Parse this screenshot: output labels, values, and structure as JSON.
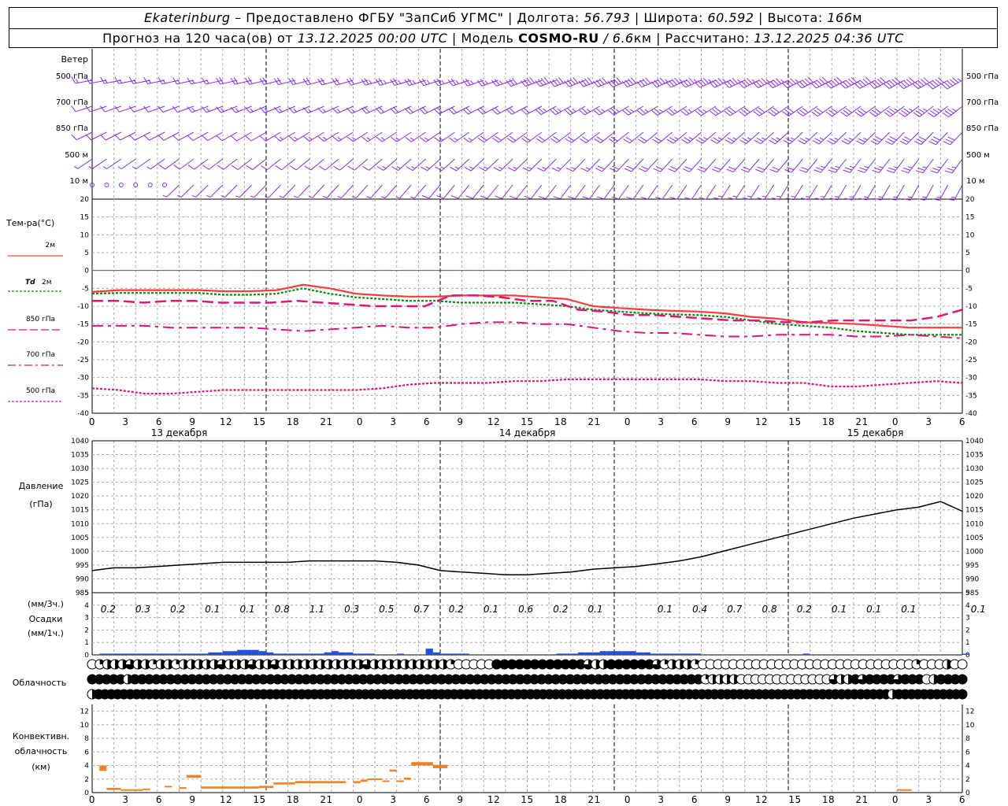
{
  "header": {
    "city": "Ekaterinburg",
    "provider": "– Предоставлено ФГБУ \"ЗапСиб УГМС\"",
    "lon_label": "| Долгота:",
    "lon": "56.793",
    "lat_label": "| Широта:",
    "lat": "60.592",
    "alt_label": "| Высота:",
    "alt": "166",
    "alt_unit": "м",
    "forecast_label": "Прогноз на 120 часа(ов) от",
    "forecast_time": "13.12.2025 00:00 UTC",
    "model_label": "| Модель",
    "model": "COSMO-RU",
    "resolution": "/ 6.6",
    "res_unit": "км",
    "computed_label": "| Рассчитано:",
    "computed_time": "13.12.2025 04:36 UTC"
  },
  "labels": {
    "wind_title": "Ветер",
    "wind_levels": [
      "500 гПа",
      "700 гПа",
      "850 гПа",
      "500 м",
      "10 м"
    ],
    "temp_title": "Тем-ра(°C)",
    "t2m": "2м",
    "td": "Td",
    "td_suffix": "2м",
    "l850": "850 гПа",
    "l700": "700 гПа",
    "l500": "500 гПа",
    "pressure_title": "Давление",
    "pressure_unit": "(гПа)",
    "precip_unit3": "(мм/3ч.)",
    "precip_title": "Осадки",
    "precip_unit1": "(мм/1ч.)",
    "cloud_title": "Облачность",
    "conv_title1": "Конвективн.",
    "conv_title2": "облачность",
    "conv_unit": "(км)"
  },
  "colors": {
    "wind": "#8a2be2",
    "t2m": "#ff3b3b",
    "td": "#0a8a0a",
    "t850": "#e0157a",
    "t700": "#e0157a",
    "t500": "#e0157a",
    "zero_line": "#3a5fd0",
    "pressure": "#000000",
    "precip": "#1f4fe0",
    "conv": "#f08020",
    "grid": "#aaaaaa"
  },
  "chart_data": [
    {
      "type": "line",
      "name": "temperature",
      "x_hours": [
        0,
        3,
        6,
        9,
        12,
        15,
        18,
        21,
        24,
        27,
        30,
        33,
        36,
        39,
        42,
        45,
        48,
        51,
        54,
        57,
        60,
        63,
        66,
        69,
        72,
        75,
        78,
        81,
        84,
        87,
        90,
        93,
        96,
        99,
        102,
        105,
        108,
        111,
        114,
        117,
        120
      ],
      "x_tick_labels": [
        "0",
        "3",
        "6",
        "9",
        "12",
        "15",
        "18",
        "21",
        "0",
        "3",
        "6",
        "9",
        "12",
        "15",
        "18",
        "21",
        "0",
        "3",
        "6",
        "9",
        "12",
        "15",
        "18",
        "21",
        "0",
        "3",
        "6"
      ],
      "date_labels": [
        "13 декабря",
        "14 декабря",
        "15 декабря"
      ],
      "ylim": [
        -40,
        20
      ],
      "y_ticks": [
        20,
        15,
        10,
        5,
        0,
        -5,
        -10,
        -15,
        -20,
        -25,
        -30,
        -35,
        -40
      ],
      "series": [
        {
          "name": "2м",
          "values": [
            -6,
            -5.5,
            -5.5,
            -5.5,
            -5.5,
            -5.8,
            -5.8,
            -5.5,
            -4,
            -5,
            -6.5,
            -7,
            -7.3,
            -7.3,
            -7,
            -7,
            -7,
            -7.5,
            -8,
            -10,
            -10.5,
            -11,
            -11.3,
            -11.5,
            -12,
            -13,
            -13.5,
            -14.5,
            -14.7,
            -15,
            -15.5,
            -16,
            -16,
            -16
          ]
        },
        {
          "name": "Td 2м",
          "values": [
            -6.5,
            -6.3,
            -6.3,
            -6.3,
            -6.3,
            -6.8,
            -6.8,
            -6.5,
            -5,
            -6.5,
            -7.5,
            -8,
            -8.5,
            -8.5,
            -9,
            -9,
            -9,
            -9.5,
            -10,
            -11,
            -11.5,
            -12,
            -12.3,
            -12.5,
            -13,
            -14,
            -15,
            -15.5,
            -16,
            -17,
            -17.5,
            -18,
            -18,
            -18
          ]
        },
        {
          "name": "850 гПа",
          "values": [
            -8.5,
            -8.5,
            -9,
            -8.5,
            -8.5,
            -9,
            -9,
            -9,
            -8.5,
            -9,
            -9.5,
            -10,
            -10,
            -10,
            -7,
            -7,
            -7.5,
            -8.5,
            -8.5,
            -11,
            -11.5,
            -12.5,
            -12.5,
            -13,
            -13.5,
            -14,
            -14,
            -14.5,
            -14.5,
            -14,
            -14,
            -14,
            -14,
            -13,
            -11
          ]
        },
        {
          "name": "700 гПа",
          "values": [
            -15.5,
            -15.5,
            -15.5,
            -16,
            -16,
            -16,
            -16,
            -16.5,
            -17,
            -16.5,
            -16,
            -15.5,
            -16,
            -16,
            -15,
            -14.5,
            -14.5,
            -15,
            -15,
            -16,
            -17,
            -17.5,
            -17.5,
            -18,
            -18.5,
            -18.5,
            -18,
            -18,
            -18,
            -18.5,
            -18.5,
            -18,
            -18.5,
            -19
          ]
        },
        {
          "name": "500 гПа",
          "values": [
            -33,
            -33.5,
            -34.5,
            -34.5,
            -34,
            -33.5,
            -33.5,
            -33.5,
            -33.5,
            -33.5,
            -33.5,
            -33,
            -32,
            -31.5,
            -31.5,
            -31.5,
            -31,
            -31,
            -30.5,
            -30.5,
            -30.5,
            -30.5,
            -30.5,
            -30.5,
            -31,
            -31,
            -31.5,
            -31.5,
            -32.5,
            -32.5,
            -32,
            -31.5,
            -31,
            -31.5
          ]
        }
      ]
    },
    {
      "type": "line",
      "name": "pressure",
      "ylim": [
        985,
        1040
      ],
      "y_ticks": [
        1040,
        1035,
        1030,
        1025,
        1020,
        1015,
        1010,
        1005,
        1000,
        995,
        990,
        985
      ],
      "x_hours": [
        0,
        3,
        6,
        9,
        12,
        15,
        18,
        21,
        24,
        27,
        30,
        33,
        36,
        39,
        42,
        45,
        48,
        51,
        54,
        57,
        60,
        63,
        66,
        69,
        72,
        75,
        78,
        81,
        84,
        87,
        90,
        93,
        96,
        99,
        102,
        105,
        108,
        111,
        114,
        117,
        120
      ],
      "values": [
        993,
        994,
        994,
        994.5,
        995,
        995.5,
        996,
        996,
        996,
        996,
        996.5,
        996.5,
        996.5,
        996.5,
        996,
        995,
        993,
        992.5,
        992,
        991.5,
        991.5,
        992,
        992.5,
        993.5,
        994,
        994.5,
        995.5,
        996.5,
        998,
        1000,
        1002,
        1004,
        1006,
        1008,
        1010,
        1012,
        1013.5,
        1015,
        1016,
        1018,
        1014.5
      ]
    },
    {
      "type": "bar",
      "name": "precipitation",
      "ylim": [
        0,
        5
      ],
      "y_ticks": [
        5,
        4,
        3,
        2,
        1,
        0
      ],
      "sums_3h": [
        "0.2",
        "0.3",
        "0.2",
        "0.1",
        "0.1",
        "0.8",
        "1.1",
        "0.3",
        "0.5",
        "0.7",
        "0.2",
        "0.1",
        "0.6",
        "0.2",
        "0.1",
        "",
        "0.1",
        "0.4",
        "0.7",
        "0.8",
        "0.2",
        "0.1",
        "0.1",
        "0.1",
        "",
        "0.1"
      ],
      "hourly_values": [
        0,
        0.1,
        0.1,
        0.1,
        0.1,
        0.1,
        0.1,
        0.1,
        0.1,
        0.1,
        0.1,
        0.1,
        0.1,
        0.1,
        0.1,
        0.1,
        0.2,
        0.2,
        0.3,
        0.3,
        0.4,
        0.4,
        0.4,
        0.3,
        0.2,
        0.1,
        0.1,
        0.1,
        0.1,
        0.1,
        0.1,
        0.1,
        0.2,
        0.3,
        0.2,
        0.2,
        0.1,
        0.1,
        0.1,
        0,
        0,
        0,
        0.1,
        0,
        0,
        0,
        0.5,
        0.2,
        0.1,
        0.1,
        0.1,
        0.1,
        0,
        0,
        0,
        0,
        0,
        0,
        0,
        0,
        0,
        0,
        0,
        0,
        0.1,
        0.1,
        0.1,
        0.2,
        0.2,
        0.2,
        0.3,
        0.3,
        0.3,
        0.3,
        0.3,
        0.2,
        0.2,
        0.1,
        0.1,
        0.1,
        0.1,
        0.1,
        0.1,
        0.1,
        0,
        0,
        0,
        0,
        0,
        0,
        0,
        0,
        0,
        0,
        0,
        0,
        0,
        0,
        0.1,
        0,
        0,
        0,
        0,
        0,
        0,
        0,
        0,
        0,
        0,
        0,
        0,
        0,
        0,
        0,
        0,
        0,
        0,
        0,
        0,
        0,
        0.1
      ]
    },
    {
      "type": "heatmap",
      "name": "cloudiness",
      "rows": [
        [
          0,
          0.25,
          0.5,
          0.5,
          0.5,
          0.75,
          0.5,
          0.5,
          0.25,
          0.5,
          0.5,
          0.25,
          0.5,
          0.5,
          0.5,
          0.5,
          0.5,
          0.75,
          0.5,
          0.5,
          0.5,
          0.75,
          0.5,
          0.5,
          0.75,
          0.5,
          0.5,
          0.5,
          0.5,
          0.5,
          0.5,
          0.5,
          0.5,
          0.5,
          0.5,
          0.5,
          0.75,
          0.5,
          0.5,
          0.5,
          0.5,
          0.5,
          0.5,
          0.5,
          0.5,
          0.5,
          0.5,
          0.25,
          0,
          0,
          0,
          0,
          0,
          1,
          1,
          1,
          1,
          1,
          1,
          1,
          1,
          1,
          1,
          1,
          1,
          0.75,
          0.5,
          0.5,
          1,
          1,
          1,
          1,
          1,
          1,
          0.75,
          0.25,
          0.5,
          0.5,
          0.5,
          0.25,
          0,
          0,
          0,
          0,
          0,
          0,
          0,
          0,
          0,
          0,
          0,
          0,
          0,
          0,
          0,
          0,
          0,
          0,
          0,
          0,
          0,
          0,
          0,
          0,
          0,
          0,
          0,
          0,
          0.25,
          0,
          0,
          0,
          0.5,
          0,
          0
        ],
        [
          1,
          1,
          1,
          1,
          1,
          0.5,
          1,
          1,
          1,
          1,
          1,
          1,
          1,
          1,
          1,
          1,
          1,
          1,
          1,
          1,
          1,
          1,
          1,
          1,
          1,
          1,
          1,
          1,
          1,
          1,
          1,
          1,
          1,
          1,
          1,
          1,
          1,
          1,
          1,
          1,
          1,
          1,
          1,
          1,
          1,
          1,
          1,
          1,
          1,
          1,
          1,
          1,
          1,
          1,
          1,
          1,
          1,
          1,
          1,
          1,
          1,
          1,
          1,
          1,
          1,
          1,
          1,
          1,
          1,
          1,
          1,
          1,
          1,
          1,
          1,
          1,
          1,
          1,
          1,
          1,
          1,
          1,
          1,
          1,
          1,
          1,
          0.25,
          0.5,
          0.5,
          0.5,
          0.5,
          0,
          0,
          0,
          0,
          0,
          0,
          0,
          0,
          0,
          0,
          0,
          0,
          0,
          0.75,
          0.5,
          0.5,
          1,
          0.75,
          1,
          1,
          1,
          1,
          0.75,
          1,
          1,
          1,
          0,
          0.5,
          1,
          1,
          1,
          1
        ],
        [
          0.5,
          1,
          1,
          1,
          1,
          1,
          1,
          1,
          1,
          1,
          1,
          1,
          1,
          1,
          1,
          1,
          1,
          1,
          1,
          1,
          1,
          1,
          1,
          1,
          1,
          1,
          1,
          1,
          1,
          1,
          1,
          1,
          1,
          1,
          1,
          1,
          1,
          1,
          1,
          1,
          1,
          1,
          1,
          1,
          1,
          1,
          1,
          1,
          1,
          1,
          1,
          1,
          1,
          1,
          1,
          1,
          1,
          1,
          1,
          1,
          1,
          1,
          1,
          1,
          1,
          1,
          1,
          1,
          1,
          1,
          1,
          1,
          1,
          1,
          1,
          1,
          1,
          1,
          1,
          1,
          1,
          1,
          1,
          1,
          1,
          1,
          1,
          1,
          1,
          1,
          1,
          1,
          1,
          1,
          1,
          1,
          1,
          1,
          1,
          1,
          1,
          1,
          1,
          1,
          1,
          1,
          1,
          1,
          1,
          1,
          1,
          1,
          1,
          1,
          1,
          1,
          1,
          1,
          1,
          1,
          1,
          1,
          1,
          1,
          1,
          1,
          0.5,
          1,
          1,
          1,
          1,
          1,
          1,
          1,
          1,
          1,
          1,
          1
        ]
      ]
    },
    {
      "type": "bar",
      "name": "convective_cloud",
      "ylim": [
        0,
        13
      ],
      "y_ticks": [
        12,
        10,
        8,
        6,
        4,
        2,
        0
      ],
      "segments": [
        {
          "h0": 1,
          "h1": 2,
          "base": 3.2,
          "top": 4
        },
        {
          "h0": 2,
          "h1": 4,
          "base": 0.4,
          "top": 0.7
        },
        {
          "h0": 4,
          "h1": 7,
          "base": 0.3,
          "top": 0.5
        },
        {
          "h0": 7,
          "h1": 8,
          "base": 0.4,
          "top": 0.6
        },
        {
          "h0": 10,
          "h1": 11,
          "base": 0.8,
          "top": 1
        },
        {
          "h0": 12,
          "h1": 13,
          "base": 0.6,
          "top": 0.8
        },
        {
          "h0": 13,
          "h1": 15,
          "base": 2.2,
          "top": 2.6
        },
        {
          "h0": 15,
          "h1": 23,
          "base": 0.6,
          "top": 0.9
        },
        {
          "h0": 23,
          "h1": 24,
          "base": 0.7,
          "top": 1.0
        },
        {
          "h0": 24,
          "h1": 25,
          "base": 0.7,
          "top": 1.0
        },
        {
          "h0": 25,
          "h1": 28,
          "base": 1.2,
          "top": 1.5
        },
        {
          "h0": 28,
          "h1": 35,
          "base": 1.4,
          "top": 1.7
        },
        {
          "h0": 36,
          "h1": 37,
          "base": 1.4,
          "top": 1.7
        },
        {
          "h0": 37,
          "h1": 38,
          "base": 1.6,
          "top": 1.9
        },
        {
          "h0": 38,
          "h1": 40,
          "base": 1.9,
          "top": 2.1
        },
        {
          "h0": 40,
          "h1": 41,
          "base": 1.6,
          "top": 1.8
        },
        {
          "h0": 41,
          "h1": 42,
          "base": 3.1,
          "top": 3.4
        },
        {
          "h0": 42,
          "h1": 43,
          "base": 1.6,
          "top": 1.8
        },
        {
          "h0": 43,
          "h1": 44,
          "base": 1.9,
          "top": 2.2
        },
        {
          "h0": 44,
          "h1": 47,
          "base": 4.0,
          "top": 4.5
        },
        {
          "h0": 47,
          "h1": 48,
          "base": 3.6,
          "top": 4.1
        },
        {
          "h0": 48,
          "h1": 49,
          "base": 3.6,
          "top": 4.1
        },
        {
          "h0": 111,
          "h1": 113,
          "base": 0.3,
          "top": 0.5
        }
      ]
    }
  ]
}
